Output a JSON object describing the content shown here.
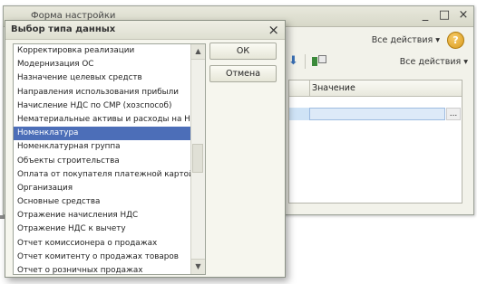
{
  "background_window": {
    "title": "Форма настройки",
    "window_buttons": {
      "minimize": "_",
      "maximize": "□",
      "close": "×"
    },
    "toolbar_top": {
      "all_actions": "Все действия ▾",
      "help": "?"
    },
    "toolbar_table": {
      "all_actions": "Все действия ▾"
    },
    "table": {
      "column_value": "Значение",
      "ellipsis": "..."
    }
  },
  "dialog": {
    "title": "Выбор типа данных",
    "close": "×",
    "ok": "ОК",
    "cancel": "Отмена",
    "selected_index": 7,
    "items": [
      "Корректировка реализации",
      "Модернизация ОС",
      "Назначение целевых средств",
      "Направления использования прибыли",
      "Начисление НДС по СМР (хозспособ)",
      "Нематериальные активы и расходы на НИ...",
      "Номенклатура",
      "Номенклатурная группа",
      "Объекты строительства",
      "Оплата от покупателя платежной картой",
      "Организация",
      "Основные средства",
      "Отражение начисления НДС",
      "Отражение НДС к вычету",
      "Отчет комиссионера о продажах",
      "Отчет комитенту о продажах товаров",
      "Отчет о розничных продажах"
    ],
    "scroll": {
      "up": "▲",
      "down": "▼"
    }
  }
}
